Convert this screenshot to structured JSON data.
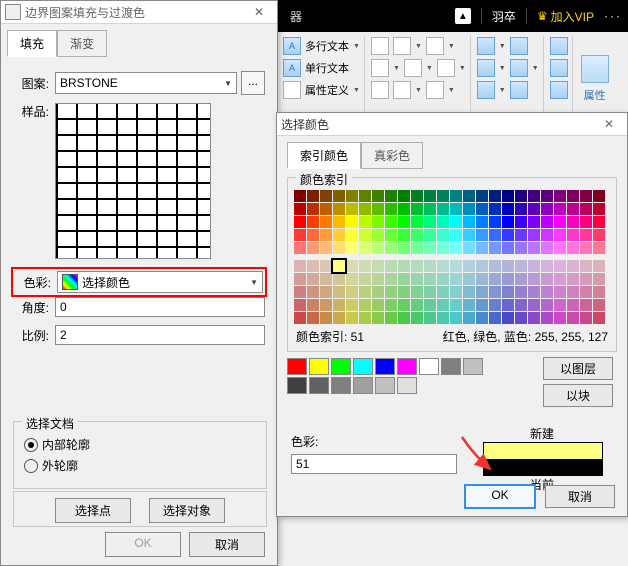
{
  "topbar": {
    "editor_suffix": "器",
    "username": "羽卒",
    "vip_label": "加入VIP",
    "more": "···"
  },
  "ribbon": {
    "multiline": "多行文本",
    "singleline": "单行文本",
    "propdef": "属性定义",
    "prop_panel": "属性"
  },
  "dialog1": {
    "title": "边界图案填充与过渡色",
    "tab_fill": "填充",
    "tab_gradient": "渐变",
    "label_pattern": "图案:",
    "pattern_value": "BRSTONE",
    "pattern_browse": "...",
    "label_sample": "样品:",
    "label_color": "色彩:",
    "color_value": "选择颜色",
    "label_angle": "角度:",
    "angle_value": "0",
    "label_scale": "比例:",
    "scale_value": "2",
    "group_pick": "选择文档",
    "radio_inner": "内部轮廓",
    "radio_outer": "外轮廓",
    "btn_pickpt": "选择点",
    "btn_pickobj": "选择对象",
    "btn_ok": "OK",
    "btn_cancel": "取消"
  },
  "dialog2": {
    "title": "选择颜色",
    "tab_index": "索引颜色",
    "tab_true": "真彩色",
    "group_index": "颜色索引",
    "index_line": "颜色索引: 51",
    "rgb_line": "红色, 绿色, 蓝色: 255, 255, 127",
    "btn_bylayer": "以图层",
    "btn_byblock": "以块",
    "label_new": "新建",
    "label_current": "当前",
    "label_color": "色彩:",
    "color_value": "51",
    "selected_hex": "#ffff7f",
    "current_hex": "#000000",
    "btn_ok": "OK",
    "btn_cancel": "取消",
    "basic_colors_row1": [
      "#ff0000",
      "#ffff00",
      "#00ff00",
      "#00ffff",
      "#0000ff",
      "#ff00ff",
      "#ffffff",
      "#808080",
      "#c0c0c0"
    ],
    "basic_colors_row2": [
      "#404040",
      "#606060",
      "#808080",
      "#a0a0a0",
      "#c0c0c0",
      "#e0e0e0"
    ]
  }
}
